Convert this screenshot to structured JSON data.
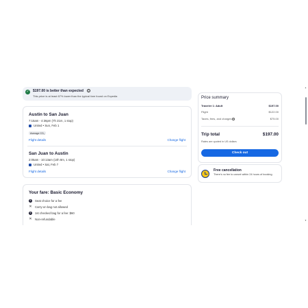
{
  "banner": {
    "headline": "$197.00 is better than expected",
    "detail": "This price is at least 67% lower than the typical fare found on Expedia",
    "check_icon": "check-icon",
    "info_icon": "info-icon"
  },
  "flights": [
    {
      "route": "Austin to San Juan",
      "times": "7:15am - 4:36pm (7h 21m, 1 stop)",
      "airline_date": "United • Sun, Feb 1",
      "badge": "Average CO₂",
      "details_link": "Flight details",
      "change_link": "Change flight"
    },
    {
      "route": "San Juan to Austin",
      "times": "2:05am - 10:13am (10h 8m, 1 stop)",
      "airline_date": "United • Sat, Feb 7",
      "details_link": "Flight details",
      "change_link": "Change flight"
    }
  ],
  "fare": {
    "title": "Your fare: Basic Economy",
    "features": [
      {
        "icon": "$",
        "text": "Seat choice for a fee"
      },
      {
        "icon": "✕",
        "text": "Carry-on bag not allowed"
      },
      {
        "icon": "$",
        "text": "1st checked bag for a fee: $60"
      },
      {
        "icon": "✕",
        "text": "Non-refundable"
      }
    ]
  },
  "summary": {
    "title": "Price summary",
    "traveler_label": "Traveler 1: Adult",
    "traveler_value": "$197.00",
    "flight_label": "Flight",
    "flight_value": "$122.00",
    "taxes_label": "Taxes, fees, and charges",
    "taxes_value": "$75.00",
    "total_label": "Trip total",
    "total_value": "$197.00",
    "currency_note": "Rates are quoted in US dollars",
    "checkout_label": "Check out"
  },
  "cancellation": {
    "title": "Free cancellation",
    "text": "There's no fee to cancel within 24 hours of booking",
    "icon": "clock-icon"
  }
}
